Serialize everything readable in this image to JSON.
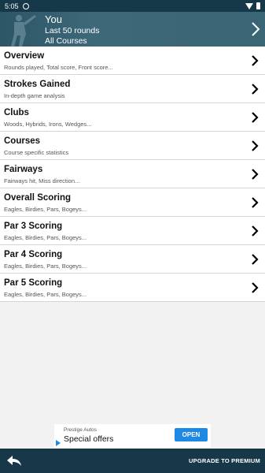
{
  "status_bar": {
    "time": "5:05"
  },
  "header": {
    "name": "You",
    "range": "Last 50 rounds",
    "course_filter": "All Courses",
    "background_color": "#2f5a6a"
  },
  "menu": [
    {
      "title": "Overview",
      "desc": "Rounds played, Total score, Front score..."
    },
    {
      "title": "Strokes Gained",
      "desc": "In-depth game analysis"
    },
    {
      "title": "Clubs",
      "desc": "Woods, Hybrids, Irons, Wedges..."
    },
    {
      "title": "Courses",
      "desc": "Course specific statistics"
    },
    {
      "title": "Fairways",
      "desc": "Fairways hit, Miss direction..."
    },
    {
      "title": "Overall Scoring",
      "desc": "Eagles, Birdies, Pars, Bogeys..."
    },
    {
      "title": "Par 3 Scoring",
      "desc": "Eagles, Birdies, Pars, Bogeys..."
    },
    {
      "title": "Par 4 Scoring",
      "desc": "Eagles, Birdies, Pars, Bogeys..."
    },
    {
      "title": "Par 5 Scoring",
      "desc": "Eagles, Birdies, Pars, Bogeys..."
    }
  ],
  "ad": {
    "brand": "Prestige Autos",
    "offer": "Special offers",
    "cta": "OPEN",
    "cta_color": "#1e88e5"
  },
  "bottom_bar": {
    "upgrade_label": "UPGRADE TO PREMIUM",
    "color": "#163848"
  }
}
